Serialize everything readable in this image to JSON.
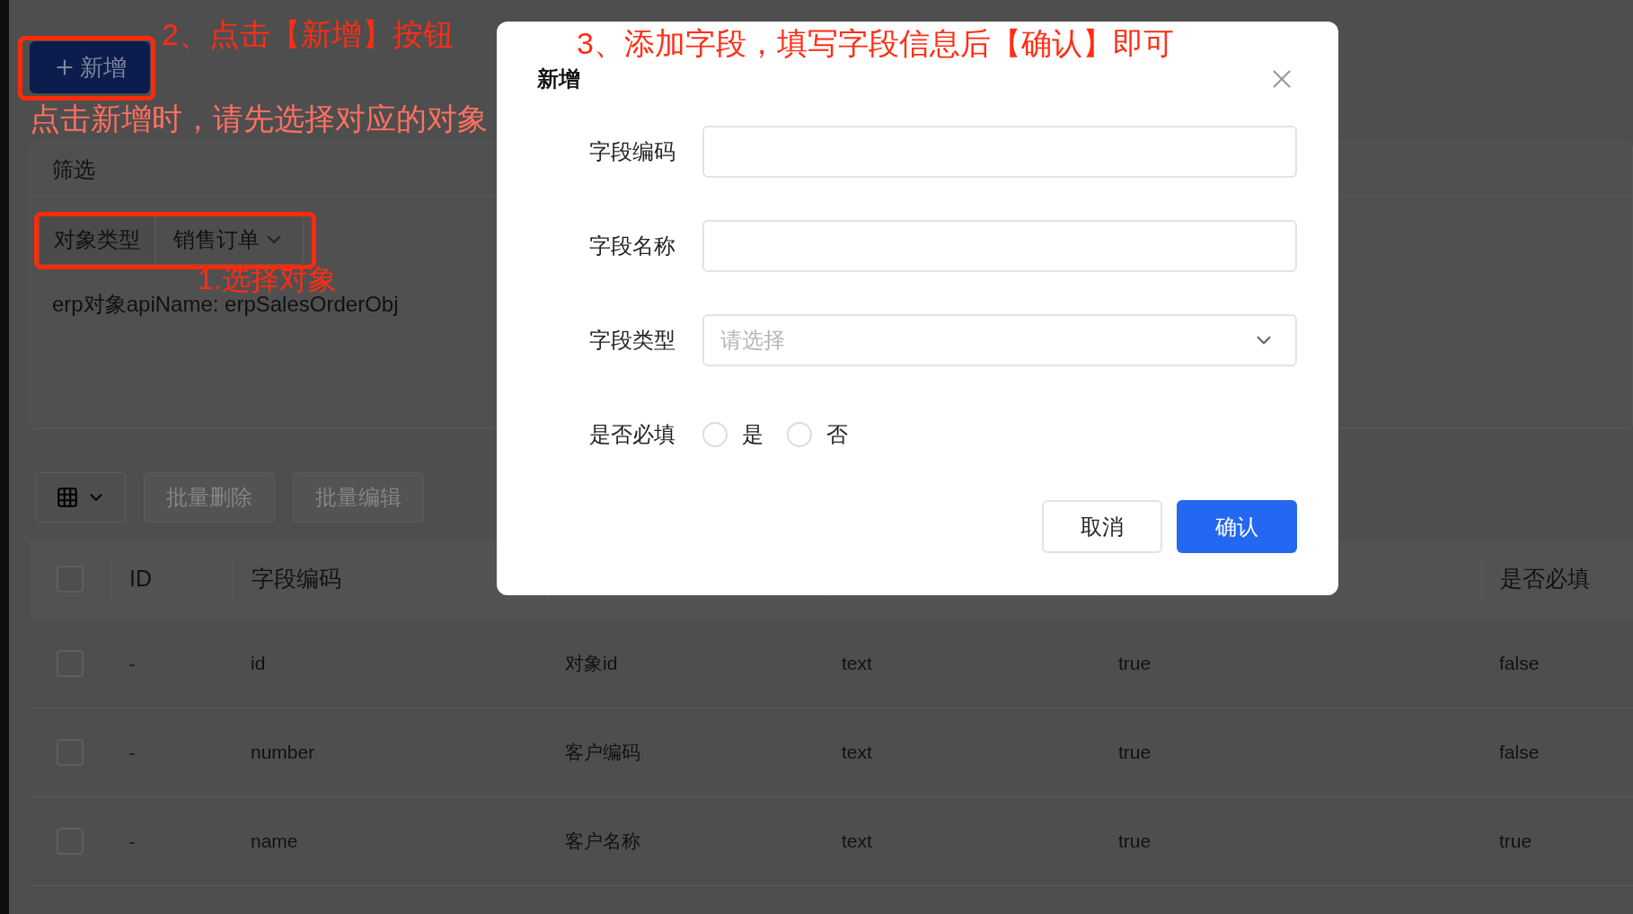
{
  "page": {
    "add_button": {
      "label": "新增"
    },
    "hint": "点击新增时，请先选择对应的对象",
    "filter": {
      "title": "筛选",
      "object_type": {
        "label": "对象类型",
        "value": "销售订单"
      },
      "api_name": "erp对象apiName: erpSalesOrderObj"
    },
    "toolbar": {
      "buttons": [
        {
          "label": "批量删除",
          "disabled": true
        },
        {
          "label": "批量编辑",
          "disabled": true
        }
      ]
    },
    "table": {
      "header_checked": false,
      "columns": [
        "ID",
        "字段编码",
        "",
        "",
        "",
        "是否必填"
      ],
      "rows": [
        {
          "checked": false,
          "cells": [
            "-",
            "id",
            "对象id",
            "text",
            "true",
            "false"
          ]
        },
        {
          "checked": false,
          "cells": [
            "-",
            "number",
            "客户编码",
            "text",
            "true",
            "false"
          ]
        },
        {
          "checked": false,
          "cells": [
            "-",
            "name",
            "客户名称",
            "text",
            "true",
            "true"
          ]
        }
      ]
    }
  },
  "annotations": [
    {
      "text": "2、点击【新增】按钮"
    },
    {
      "text": "1.选择对象"
    },
    {
      "text": "3、添加字段，填写字段信息后【确认】即可"
    }
  ],
  "dialog": {
    "title": "新增",
    "fields": [
      {
        "kind": "text",
        "label": "字段编码"
      },
      {
        "kind": "text",
        "label": "字段名称"
      },
      {
        "kind": "select",
        "label": "字段类型",
        "placeholder": "请选择"
      },
      {
        "kind": "radio",
        "label": "是否必填",
        "options": [
          {
            "label": "是",
            "selected": false
          },
          {
            "label": "否",
            "selected": false
          }
        ]
      }
    ],
    "buttons": [
      {
        "label": "取消",
        "primary": false
      },
      {
        "label": "确认",
        "primary": true
      }
    ]
  }
}
